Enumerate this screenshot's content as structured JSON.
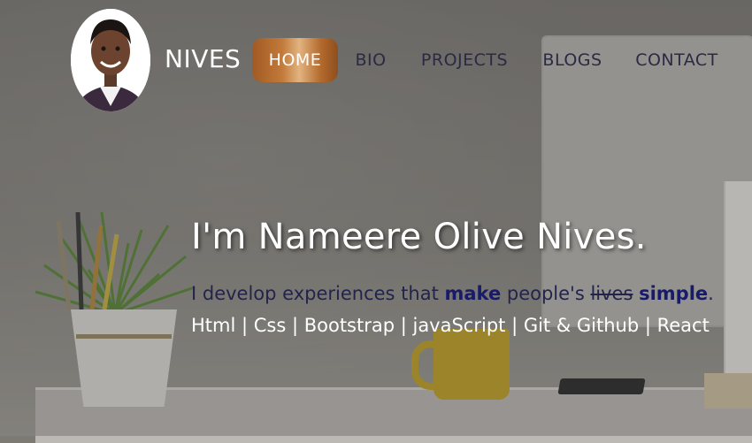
{
  "header": {
    "brand": "NIVES",
    "nav": [
      {
        "label": "HOME",
        "active": true
      },
      {
        "label": "BIO",
        "active": false
      },
      {
        "label": "PROJECTS",
        "active": false
      },
      {
        "label": "BLOGS",
        "active": false
      },
      {
        "label": "CONTACT",
        "active": false
      }
    ]
  },
  "hero": {
    "title": "I'm Nameere Olive Nives.",
    "subtitle": {
      "part1": "I develop experiences that ",
      "highlight1": "make",
      "part2": " people's ",
      "struck": "lives",
      "part3": " ",
      "highlight2": "simple",
      "part4": "."
    },
    "skills": "Html | Css | Bootstrap | javaScript | Git & Github | React"
  },
  "colors": {
    "active_nav_gradient": [
      "#a05a23",
      "#e2b380"
    ],
    "nav_text": "#2a2a44",
    "hero_title": "#ffffff"
  }
}
